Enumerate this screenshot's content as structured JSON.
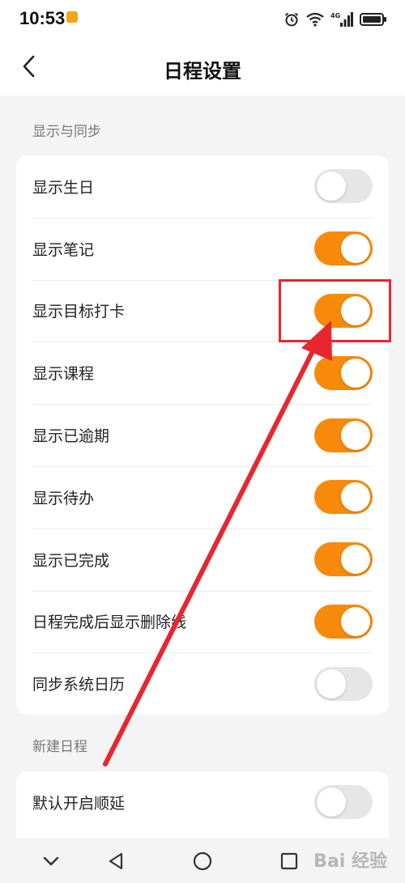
{
  "status_bar": {
    "time": "10:53",
    "signal_label": "4G"
  },
  "header": {
    "title": "日程设置"
  },
  "sections": [
    {
      "label": "显示与同步",
      "items": [
        {
          "label": "显示生日",
          "on": false
        },
        {
          "label": "显示笔记",
          "on": true
        },
        {
          "label": "显示目标打卡",
          "on": true
        },
        {
          "label": "显示课程",
          "on": true
        },
        {
          "label": "显示已逾期",
          "on": true
        },
        {
          "label": "显示待办",
          "on": true
        },
        {
          "label": "显示已完成",
          "on": true
        },
        {
          "label": "日程完成后显示删除线",
          "on": true
        },
        {
          "label": "同步系统日历",
          "on": false
        }
      ]
    },
    {
      "label": "新建日程",
      "items": [
        {
          "label": "默认开启顺延",
          "on": false
        }
      ]
    }
  ],
  "watermark": "Bai 经验",
  "colors": {
    "accent": "#f78a0a",
    "toggle_off": "#e6e6e6",
    "annotation": "#e8262e"
  }
}
